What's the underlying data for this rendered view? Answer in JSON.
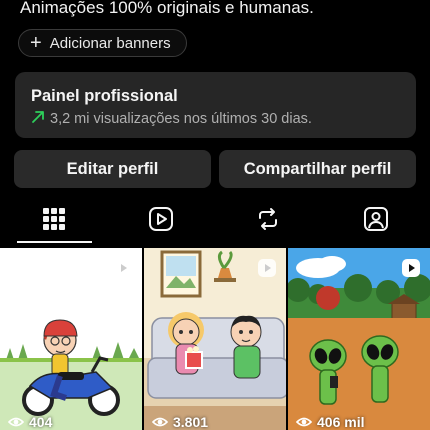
{
  "profile": {
    "bio": "Animações 100% originais e humanas."
  },
  "banners": {
    "add_label": "Adicionar banners"
  },
  "dashboard": {
    "title": "Painel profissional",
    "stats": "3,2 mi visualizações nos últimos 30 dias."
  },
  "actions": {
    "edit_label": "Editar perfil",
    "share_label": "Compartilhar perfil"
  },
  "tabs": [
    {
      "icon": "grid-icon",
      "active": true
    },
    {
      "icon": "reels-icon",
      "active": false
    },
    {
      "icon": "reposts-icon",
      "active": false
    },
    {
      "icon": "tagged-icon",
      "active": false
    }
  ],
  "posts": [
    {
      "views": "404",
      "type": "reel"
    },
    {
      "views": "3.801",
      "type": "reel"
    },
    {
      "views": "406 mil",
      "type": "reel"
    }
  ],
  "colors": {
    "background": "#000000",
    "card": "#262626",
    "button": "#2a2a2a",
    "trend_up": "#2ecf5b"
  }
}
